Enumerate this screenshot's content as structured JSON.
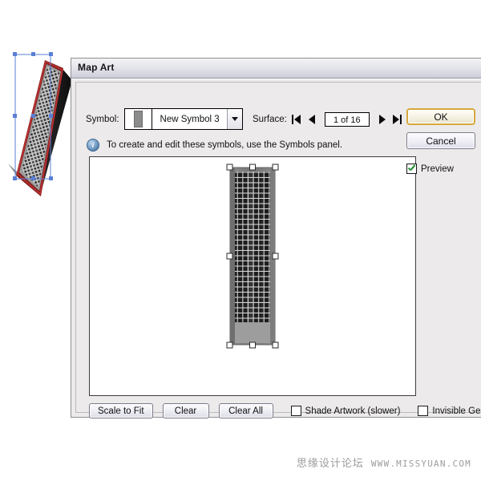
{
  "dialog": {
    "title": "Map Art",
    "symbol": {
      "label": "Symbol:",
      "swatch_icon": "symbol-thumbnail-icon",
      "value": "New Symbol 3",
      "dropdown_icon": "chevron-down-icon"
    },
    "surface": {
      "label": "Surface:",
      "first_icon": "first-surface-icon",
      "prev_icon": "previous-surface-icon",
      "value": "1 of 16",
      "next_icon": "next-surface-icon",
      "last_icon": "last-surface-icon"
    },
    "hint": {
      "icon": "info-icon",
      "icon_glyph": "i",
      "text": "To create and edit these symbols, use the Symbols panel."
    },
    "bottom_controls": {
      "scale_to_fit": "Scale to Fit",
      "clear": "Clear",
      "clear_all": "Clear All",
      "shade_artwork": "Shade Artwork (slower)",
      "shade_artwork_checked": false,
      "invisible_geometry": "Invisible Geometry",
      "invisible_geometry_checked": false
    },
    "side_buttons": {
      "ok": "OK",
      "cancel": "Cancel",
      "preview": "Preview",
      "preview_checked": true
    },
    "colors": {
      "ok_accent": "#d6a83c",
      "check_green": "#1f8a2e",
      "info_blue": "#5d89b4",
      "title_text": "#15151a"
    }
  },
  "artwork": {
    "name": "skyscraper-symbol-art",
    "frame_color": "#7e7e7e",
    "window_grid_color": "#1d1d1d",
    "base_color": "#9b9b9b",
    "handle_fill": "#ffffff",
    "handle_stroke": "#2a2a2a",
    "grid_columns": 9,
    "grid_rows": 33
  },
  "preview_3d": {
    "name": "extruded-3d-object",
    "selection_color": "#5a7fd4",
    "edge_highlight_color": "#aa2b2b",
    "face_color": "#d8d8d8",
    "side_color": "#1b1b1b"
  },
  "watermark": {
    "chinese": "思缘设计论坛",
    "url": "WWW.MISSYUAN.COM"
  }
}
